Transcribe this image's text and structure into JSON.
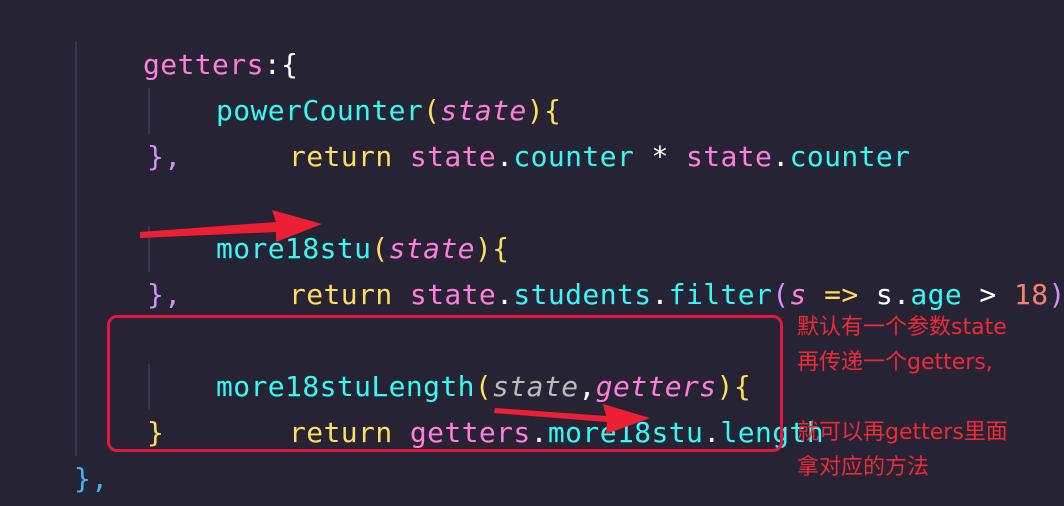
{
  "code": {
    "line1": {
      "name": "getters",
      "punct": ":{"
    },
    "line2": {
      "name": "powerCounter",
      "open": "(",
      "param": "state",
      "close": ")",
      "brace": "{"
    },
    "line3": {
      "kw": "return",
      "a": "state",
      "dot1": ".",
      "b": "counter",
      "op": " * ",
      "c": "state",
      "dot2": ".",
      "d": "counter"
    },
    "line4": {
      "text": "},"
    },
    "line5": {
      "name": "more18stu",
      "open": "(",
      "param": "state",
      "close": ")",
      "brace": "{"
    },
    "line6": {
      "kw": "return",
      "a": "state",
      "dot1": ".",
      "b": "students",
      "dot2": ".",
      "c": "filter",
      "open": "(",
      "s1": "s",
      "arrow": " => ",
      "s2": "s",
      "dot3": ".",
      "age": "age",
      "gt": " > ",
      "num": "18",
      "close": ")"
    },
    "line7": {
      "text": "},"
    },
    "line8": {
      "name": "more18stuLength",
      "open": "(",
      "p1": "state",
      "comma": ",",
      "p2": "getters",
      "close": ")",
      "brace": "{"
    },
    "line9": {
      "kw": "return",
      "a": "getters",
      "dot1": ".",
      "b": "more18stu",
      "dot2": ".",
      "c": "length"
    },
    "line10": {
      "text": "}"
    },
    "line11": {
      "text": "},"
    }
  },
  "annotation": {
    "line1": "默认有一个参数state",
    "line2": "再传递一个getters,",
    "line3": "就可以再getters里面",
    "line4": "拿对应的方法"
  },
  "colors": {
    "background": "#262335",
    "annotation": "#ee2a38",
    "box": "#e5153b"
  }
}
